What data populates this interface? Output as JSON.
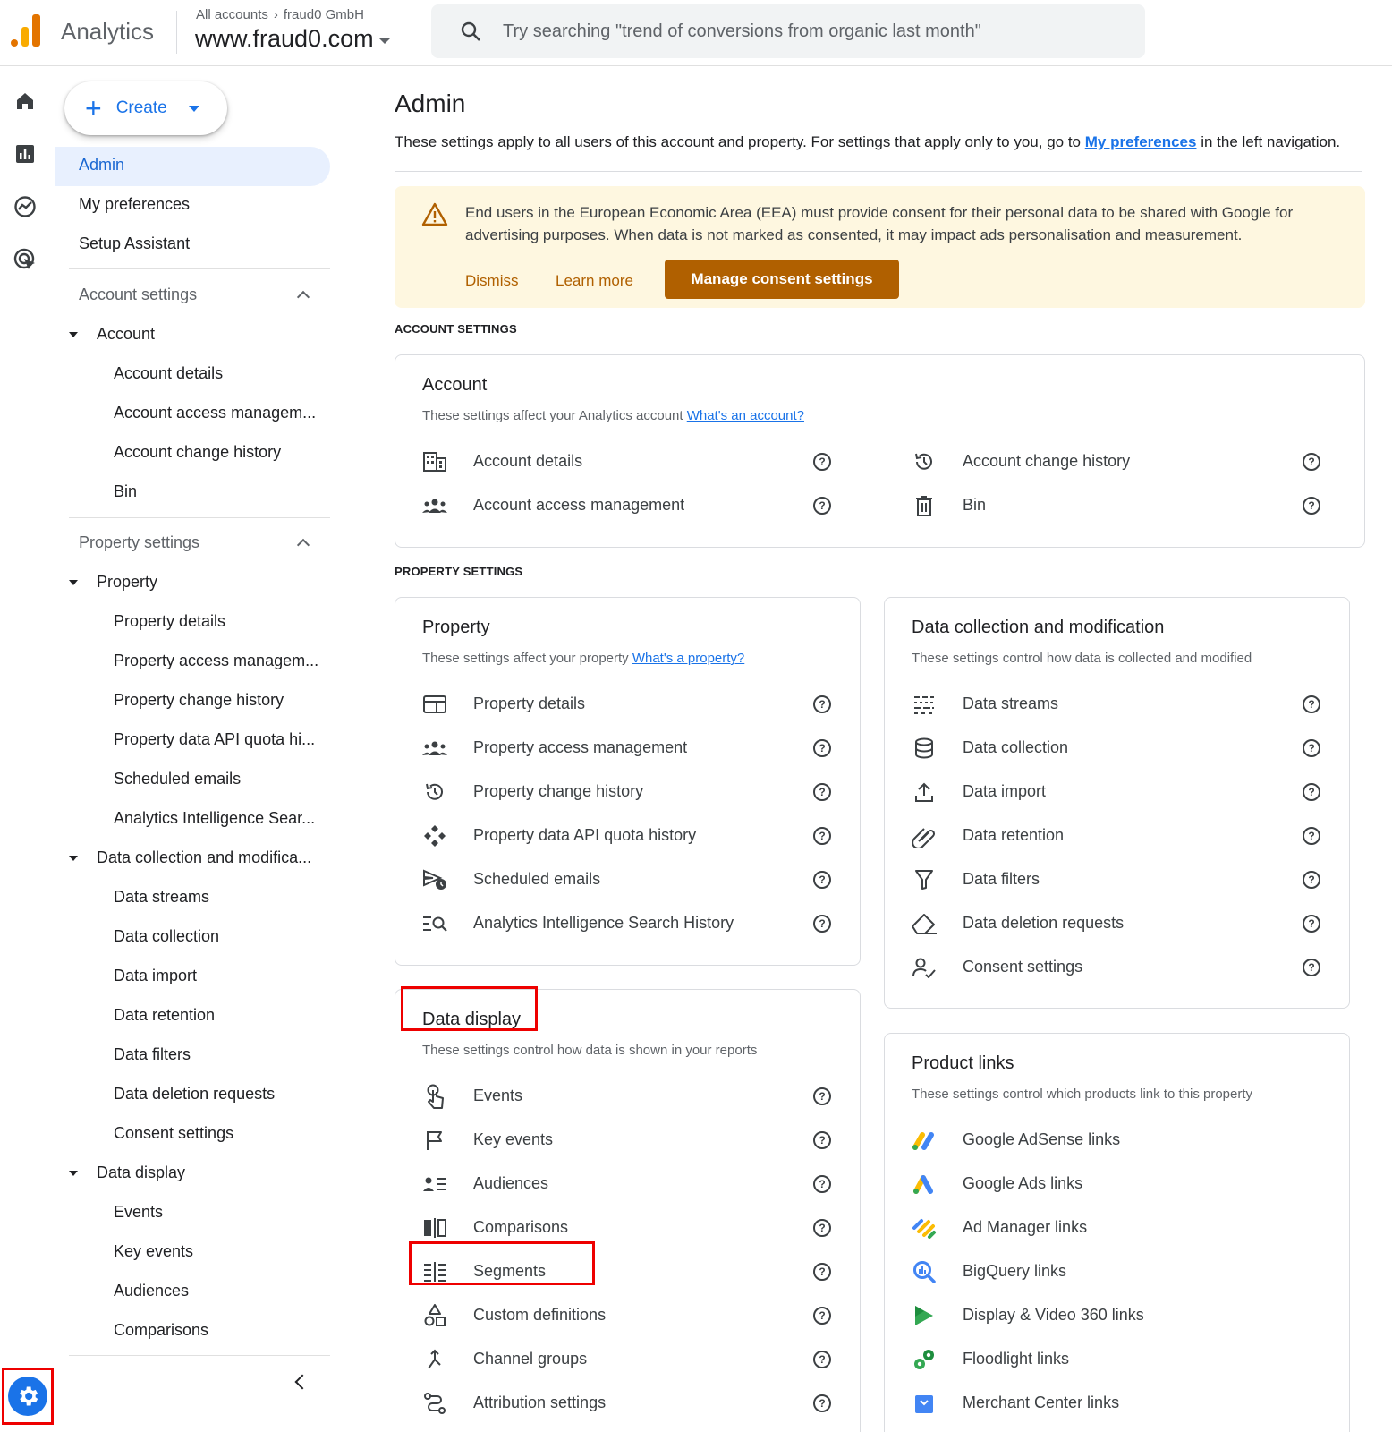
{
  "app": {
    "name": "Analytics"
  },
  "header": {
    "breadcrumb_all": "All accounts",
    "breadcrumb_account": "fraud0 GmbH",
    "property": "www.fraud0.com",
    "search_placeholder": "Try searching \"trend of conversions from organic last month\""
  },
  "create_label": "Create",
  "nav": {
    "top": [
      "Admin",
      "My preferences",
      "Setup Assistant"
    ],
    "account_settings": "Account settings",
    "account": "Account",
    "account_items": [
      "Account details",
      "Account access managem...",
      "Account change history",
      "Bin"
    ],
    "property_settings": "Property settings",
    "property": "Property",
    "property_items": [
      "Property details",
      "Property access managem...",
      "Property change history",
      "Property data API quota hi...",
      "Scheduled emails",
      "Analytics Intelligence Sear..."
    ],
    "data_collection": "Data collection and modifica...",
    "data_collection_items": [
      "Data streams",
      "Data collection",
      "Data import",
      "Data retention",
      "Data filters",
      "Data deletion requests",
      "Consent settings"
    ],
    "data_display": "Data display",
    "data_display_items": [
      "Events",
      "Key events",
      "Audiences",
      "Comparisons"
    ]
  },
  "main": {
    "title": "Admin",
    "desc_prefix": "These settings apply to all users of this account and property. For settings that apply only to you, go to ",
    "desc_link": "My preferences",
    "desc_suffix": " in the left navigation.",
    "banner": {
      "message": "End users in the European Economic Area (EEA) must provide consent for their personal data to be shared with Google for advertising purposes. When data is not marked as consented, it may impact ads personalisation and measurement.",
      "dismiss": "Dismiss",
      "learn_more": "Learn more",
      "manage": "Manage consent settings"
    },
    "account_settings_label": "ACCOUNT SETTINGS",
    "property_settings_label": "PROPERTY SETTINGS",
    "account_card": {
      "title": "Account",
      "desc": "These settings affect your Analytics account ",
      "desc_link": "What's an account?",
      "items": [
        "Account details",
        "Account access management",
        "Account change history",
        "Bin"
      ]
    },
    "property_card": {
      "title": "Property",
      "desc": "These settings affect your property ",
      "desc_link": "What's a property?",
      "items": [
        "Property details",
        "Property access management",
        "Property change history",
        "Property data API quota history",
        "Scheduled emails",
        "Analytics Intelligence Search History"
      ]
    },
    "data_collection_card": {
      "title": "Data collection and modification",
      "desc": "These settings control how data is collected and modified",
      "items": [
        "Data streams",
        "Data collection",
        "Data import",
        "Data retention",
        "Data filters",
        "Data deletion requests",
        "Consent settings"
      ]
    },
    "data_display_card": {
      "title": "Data display",
      "desc": "These settings control how data is shown in your reports",
      "items": [
        "Events",
        "Key events",
        "Audiences",
        "Comparisons",
        "Segments",
        "Custom definitions",
        "Channel groups",
        "Attribution settings"
      ]
    },
    "product_links_card": {
      "title": "Product links",
      "desc": "These settings control which products link to this property",
      "items": [
        "Google AdSense links",
        "Google Ads links",
        "Ad Manager links",
        "BigQuery links",
        "Display & Video 360 links",
        "Floodlight links",
        "Merchant Center links"
      ]
    }
  },
  "colors": {
    "accent": "#1a73e8",
    "warning_bg": "#fef7e0",
    "warning_button": "#b06000",
    "highlight": "#ee0000"
  },
  "help_glyph": "?"
}
